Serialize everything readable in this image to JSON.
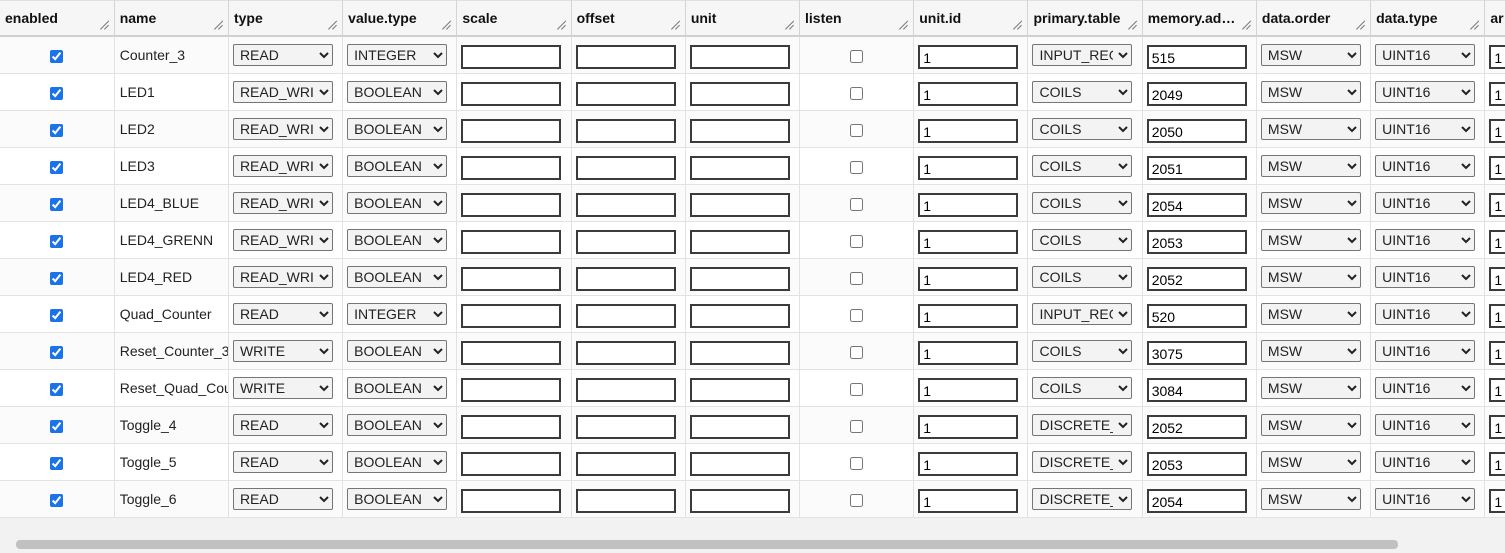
{
  "columns": [
    {
      "key": "enabled",
      "label": "enabled"
    },
    {
      "key": "name",
      "label": "name"
    },
    {
      "key": "type",
      "label": "type"
    },
    {
      "key": "value_type",
      "label": "value.type"
    },
    {
      "key": "scale",
      "label": "scale"
    },
    {
      "key": "offset",
      "label": "offset"
    },
    {
      "key": "unit",
      "label": "unit"
    },
    {
      "key": "listen",
      "label": "listen"
    },
    {
      "key": "unit_id",
      "label": "unit.id"
    },
    {
      "key": "primary_table",
      "label": "primary.table"
    },
    {
      "key": "memory_address",
      "label": "memory.add..."
    },
    {
      "key": "data_order",
      "label": "data.order"
    },
    {
      "key": "data_type",
      "label": "data.type"
    },
    {
      "key": "ar",
      "label": "ar"
    }
  ],
  "rows": [
    {
      "enabled": true,
      "name": "Counter_3",
      "type": "READ",
      "value_type": "INTEGER",
      "scale": "",
      "offset": "",
      "unit": "",
      "listen": false,
      "unit_id": "1",
      "primary_table": "INPUT_REG",
      "memory_address": "515",
      "data_order": "MSW",
      "data_type": "UINT16",
      "ar": "1"
    },
    {
      "enabled": true,
      "name": "LED1",
      "type": "READ_WRIT",
      "value_type": "BOOLEAN",
      "scale": "",
      "offset": "",
      "unit": "",
      "listen": false,
      "unit_id": "1",
      "primary_table": "COILS",
      "memory_address": "2049",
      "data_order": "MSW",
      "data_type": "UINT16",
      "ar": "1"
    },
    {
      "enabled": true,
      "name": "LED2",
      "type": "READ_WRIT",
      "value_type": "BOOLEAN",
      "scale": "",
      "offset": "",
      "unit": "",
      "listen": false,
      "unit_id": "1",
      "primary_table": "COILS",
      "memory_address": "2050",
      "data_order": "MSW",
      "data_type": "UINT16",
      "ar": "1"
    },
    {
      "enabled": true,
      "name": "LED3",
      "type": "READ_WRIT",
      "value_type": "BOOLEAN",
      "scale": "",
      "offset": "",
      "unit": "",
      "listen": false,
      "unit_id": "1",
      "primary_table": "COILS",
      "memory_address": "2051",
      "data_order": "MSW",
      "data_type": "UINT16",
      "ar": "1"
    },
    {
      "enabled": true,
      "name": "LED4_BLUE",
      "type": "READ_WRIT",
      "value_type": "BOOLEAN",
      "scale": "",
      "offset": "",
      "unit": "",
      "listen": false,
      "unit_id": "1",
      "primary_table": "COILS",
      "memory_address": "2054",
      "data_order": "MSW",
      "data_type": "UINT16",
      "ar": "1"
    },
    {
      "enabled": true,
      "name": "LED4_GRENN",
      "type": "READ_WRIT",
      "value_type": "BOOLEAN",
      "scale": "",
      "offset": "",
      "unit": "",
      "listen": false,
      "unit_id": "1",
      "primary_table": "COILS",
      "memory_address": "2053",
      "data_order": "MSW",
      "data_type": "UINT16",
      "ar": "1"
    },
    {
      "enabled": true,
      "name": "LED4_RED",
      "type": "READ_WRIT",
      "value_type": "BOOLEAN",
      "scale": "",
      "offset": "",
      "unit": "",
      "listen": false,
      "unit_id": "1",
      "primary_table": "COILS",
      "memory_address": "2052",
      "data_order": "MSW",
      "data_type": "UINT16",
      "ar": "1"
    },
    {
      "enabled": true,
      "name": "Quad_Counter",
      "type": "READ",
      "value_type": "INTEGER",
      "scale": "",
      "offset": "",
      "unit": "",
      "listen": false,
      "unit_id": "1",
      "primary_table": "INPUT_REG",
      "memory_address": "520",
      "data_order": "MSW",
      "data_type": "UINT16",
      "ar": "1"
    },
    {
      "enabled": true,
      "name": "Reset_Counter_3",
      "type": "WRITE",
      "value_type": "BOOLEAN",
      "scale": "",
      "offset": "",
      "unit": "",
      "listen": false,
      "unit_id": "1",
      "primary_table": "COILS",
      "memory_address": "3075",
      "data_order": "MSW",
      "data_type": "UINT16",
      "ar": "1"
    },
    {
      "enabled": true,
      "name": "Reset_Quad_Counter",
      "type": "WRITE",
      "value_type": "BOOLEAN",
      "scale": "",
      "offset": "",
      "unit": "",
      "listen": false,
      "unit_id": "1",
      "primary_table": "COILS",
      "memory_address": "3084",
      "data_order": "MSW",
      "data_type": "UINT16",
      "ar": "1"
    },
    {
      "enabled": true,
      "name": "Toggle_4",
      "type": "READ",
      "value_type": "BOOLEAN",
      "scale": "",
      "offset": "",
      "unit": "",
      "listen": false,
      "unit_id": "1",
      "primary_table": "DISCRETE_",
      "memory_address": "2052",
      "data_order": "MSW",
      "data_type": "UINT16",
      "ar": "1"
    },
    {
      "enabled": true,
      "name": "Toggle_5",
      "type": "READ",
      "value_type": "BOOLEAN",
      "scale": "",
      "offset": "",
      "unit": "",
      "listen": false,
      "unit_id": "1",
      "primary_table": "DISCRETE_",
      "memory_address": "2053",
      "data_order": "MSW",
      "data_type": "UINT16",
      "ar": "1"
    },
    {
      "enabled": true,
      "name": "Toggle_6",
      "type": "READ",
      "value_type": "BOOLEAN",
      "scale": "",
      "offset": "",
      "unit": "",
      "listen": false,
      "unit_id": "1",
      "primary_table": "DISCRETE_",
      "memory_address": "2054",
      "data_order": "MSW",
      "data_type": "UINT16",
      "ar": "1"
    }
  ],
  "icons": {
    "column_resize": "resize-grip-icon"
  },
  "colors": {
    "checkbox_accent": "#1a73e8",
    "header_bg": "#f6f6f6",
    "row_alt_bg": "#fbfbfb"
  }
}
